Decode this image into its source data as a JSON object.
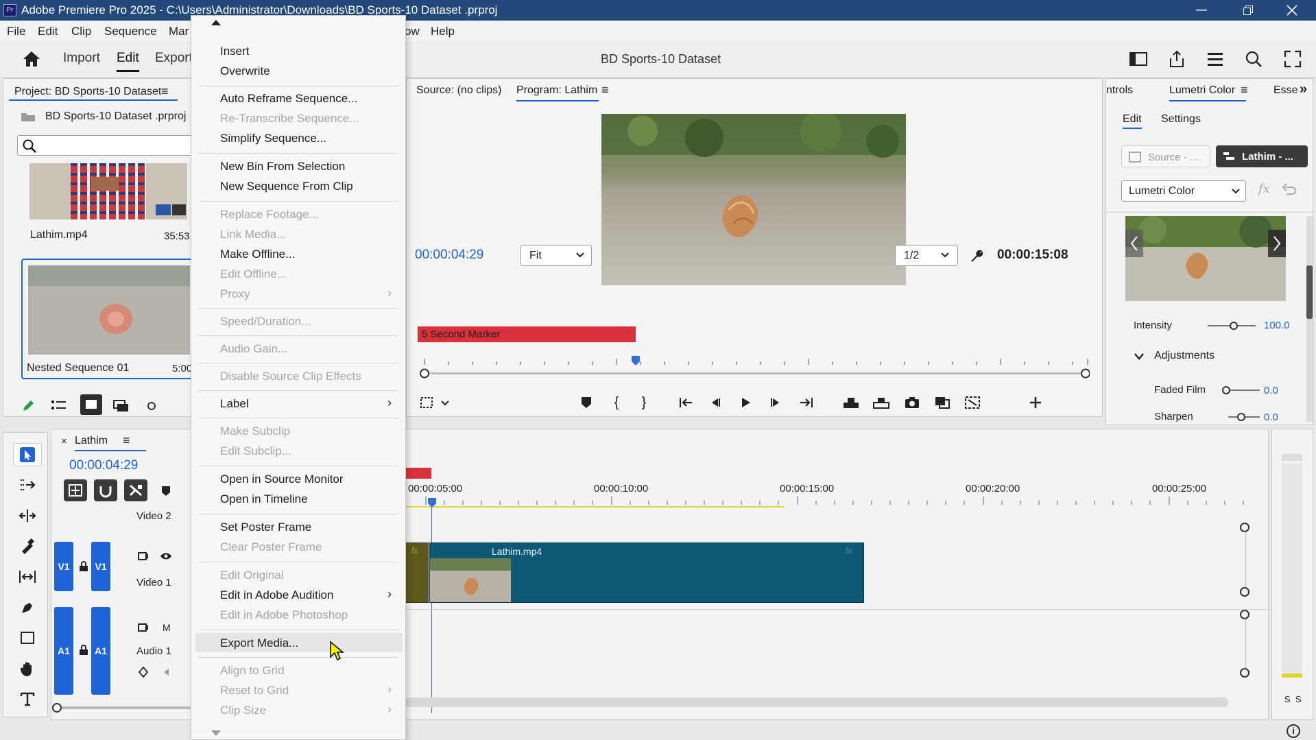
{
  "window": {
    "title": "Adobe Premiere Pro 2025 - C:\\Users\\Administrator\\Downloads\\BD Sports-10 Dataset .prproj",
    "app_badge": "Pr"
  },
  "menubar": [
    "File",
    "Edit",
    "Clip",
    "Sequence",
    "Mar",
    "ow",
    "Help"
  ],
  "toolbar": {
    "import": "Import",
    "edit": "Edit",
    "export": "Export",
    "project_title": "BD Sports-10 Dataset"
  },
  "project": {
    "tab": "Project: BD Sports-10 Dataset",
    "file": "BD Sports-10 Dataset .prproj",
    "search_placeholder": "",
    "items": [
      {
        "name": "Lathim.mp4",
        "duration": "35:53"
      },
      {
        "name": "Nested Sequence 01",
        "duration": "5:00"
      }
    ]
  },
  "source_tab": "Source: (no clips)",
  "program": {
    "tab": "Program: Lathim",
    "timecode": "00:00:04:29",
    "fit": "Fit",
    "resolution": "1/2",
    "duration": "00:00:15:08",
    "marker": "5 Second Marker"
  },
  "lumetri": {
    "tab_left": "ntrols",
    "tab": "Lumetri Color",
    "tab_right": "Esse",
    "edit": "Edit",
    "settings": "Settings",
    "source_btn": "Source - ...",
    "clip_btn": "Lathim - ...",
    "effect": "Lumetri Color",
    "intensity_label": "Intensity",
    "intensity_value": "100.0",
    "adjustments": "Adjustments",
    "faded_label": "Faded Film",
    "faded_value": "0.0",
    "sharpen_label": "Sharpen",
    "sharpen_value": "0.0"
  },
  "timeline": {
    "tab": "Lathim",
    "timecode": "00:00:04:29",
    "ruler": [
      "00:00:05:00",
      "00:00:10:00",
      "00:00:15:00",
      "00:00:20:00",
      "00:00:25:00"
    ],
    "clip": "Lathim.mp4",
    "fx": "fx",
    "tracks": {
      "v2": "Video 2",
      "v1": "Video 1",
      "a1": "Audio 1",
      "v1_badge": "V1",
      "a1_badge": "A1",
      "m": "M"
    }
  },
  "meter": {
    "s1": "S",
    "s2": "S"
  },
  "context_menu": {
    "items": [
      {
        "label": "Insert",
        "enabled": true
      },
      {
        "label": "Overwrite",
        "enabled": true
      },
      {
        "label": "Auto Reframe Sequence...",
        "enabled": true
      },
      {
        "label": "Re-Transcribe Sequence...",
        "enabled": false
      },
      {
        "label": "Simplify Sequence...",
        "enabled": true
      },
      {
        "label": "New Bin From Selection",
        "enabled": true
      },
      {
        "label": "New Sequence From Clip",
        "enabled": true
      },
      {
        "label": "Replace Footage...",
        "enabled": false
      },
      {
        "label": "Link Media...",
        "enabled": false
      },
      {
        "label": "Make Offline...",
        "enabled": true
      },
      {
        "label": "Edit Offline...",
        "enabled": false
      },
      {
        "label": "Proxy",
        "enabled": false,
        "submenu": true
      },
      {
        "label": "Speed/Duration...",
        "enabled": false
      },
      {
        "label": "Audio Gain...",
        "enabled": false
      },
      {
        "label": "Disable Source Clip Effects",
        "enabled": false
      },
      {
        "label": "Label",
        "enabled": true,
        "submenu": true
      },
      {
        "label": "Make Subclip",
        "enabled": false
      },
      {
        "label": "Edit Subclip...",
        "enabled": false
      },
      {
        "label": "Open in Source Monitor",
        "enabled": true
      },
      {
        "label": "Open in Timeline",
        "enabled": true
      },
      {
        "label": "Set Poster Frame",
        "enabled": true
      },
      {
        "label": "Clear Poster Frame",
        "enabled": false
      },
      {
        "label": "Edit Original",
        "enabled": false
      },
      {
        "label": "Edit in Adobe Audition",
        "enabled": true,
        "submenu": true
      },
      {
        "label": "Edit in Adobe Photoshop",
        "enabled": false
      },
      {
        "label": "Export Media...",
        "enabled": true,
        "hovered": true
      },
      {
        "label": "Align to Grid",
        "enabled": false
      },
      {
        "label": "Reset to Grid",
        "enabled": false,
        "submenu": true
      },
      {
        "label": "Clip Size",
        "enabled": false,
        "submenu": true
      }
    ]
  },
  "colors": {
    "titlebar": "#23497a",
    "accent": "#1f63d8",
    "marker": "#d8313c",
    "clip": "#0d5873"
  }
}
